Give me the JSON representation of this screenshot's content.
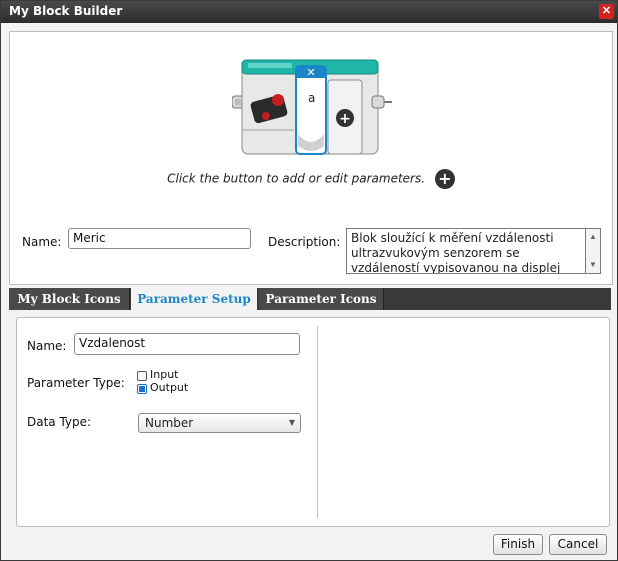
{
  "window": {
    "title": "My Block Builder"
  },
  "top": {
    "hint": "Click the button to add or edit parameters.",
    "block_param_label": "a",
    "name_label": "Name:",
    "name_value": "Meric",
    "description_label": "Description:",
    "description_value": "Blok sloužící k měření vzdálenosti ultrazvukovým senzorem se vzdáleností vypisovanou na displej"
  },
  "tabs": [
    {
      "label": "My Block Icons",
      "active": false
    },
    {
      "label": "Parameter Setup",
      "active": true
    },
    {
      "label": "Parameter Icons",
      "active": false
    }
  ],
  "parameter": {
    "name_label": "Name:",
    "name_value": "Vzdalenost",
    "type_label": "Parameter Type:",
    "type_options": [
      {
        "label": "Input",
        "checked": false
      },
      {
        "label": "Output",
        "checked": true
      }
    ],
    "data_type_label": "Data Type:",
    "data_type_value": "Number"
  },
  "buttons": {
    "finish": "Finish",
    "cancel": "Cancel"
  },
  "colors": {
    "accent": "#1a86c8",
    "block_teal": "#1fb5a8",
    "close_red": "#d42020"
  }
}
